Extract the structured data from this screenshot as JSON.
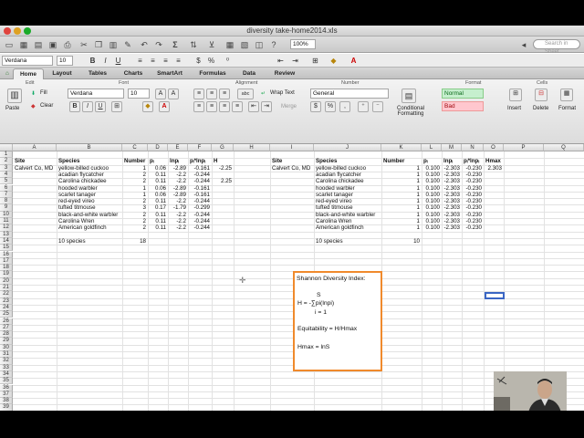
{
  "window": {
    "title": "diversity take-home2014.xls"
  },
  "toolbar": {
    "zoom": "100%",
    "search_placeholder": "Search in Sheet"
  },
  "formatbar": {
    "font": "Verdana",
    "size": "10",
    "bold": "B",
    "italic": "I",
    "underline": "U"
  },
  "ribbon_tabs": [
    "Home",
    "Layout",
    "Tables",
    "Charts",
    "SmartArt",
    "Formulas",
    "Data",
    "Review"
  ],
  "ribbon": {
    "groups": {
      "edit": "Edit",
      "font": "Font",
      "alignment": "Alignment",
      "number": "Number",
      "format": "Format",
      "cells": "Cells"
    },
    "fill": "Fill",
    "clear": "Clear",
    "paste": "Paste",
    "font": "Verdana",
    "size": "10",
    "wrap": "Wrap Text",
    "merge": "Merge",
    "number_format": "General",
    "styles": {
      "normal": "Normal",
      "bad": "Bad"
    },
    "conditional": "Conditional Formatting",
    "insert": "Insert",
    "delete": "Delete",
    "format_btn": "Format",
    "abc": "abc"
  },
  "grid": {
    "columns": [
      "A",
      "B",
      "C",
      "D",
      "E",
      "F",
      "G",
      "H",
      "I",
      "J",
      "K",
      "L",
      "M",
      "N",
      "O",
      "P",
      "Q"
    ],
    "rows": [
      "1",
      "2",
      "3",
      "4",
      "5",
      "6",
      "7",
      "8",
      "9",
      "10",
      "11",
      "12",
      "13",
      "14",
      "15",
      "16",
      "17",
      "18",
      "19",
      "20",
      "21",
      "22",
      "23",
      "24",
      "25",
      "26",
      "27",
      "28",
      "29",
      "30",
      "31",
      "32",
      "33",
      "34",
      "35",
      "36",
      "37",
      "38",
      "39"
    ],
    "left": {
      "headers": [
        "Site",
        "Species",
        "Number",
        "pᵢ",
        "lnpᵢ",
        "pᵢ*lnpᵢ",
        "H"
      ],
      "site": "Calvert Co, MD",
      "rows": [
        [
          "yellow-billed cuckoo",
          "1",
          "0.06",
          "-2.89",
          "-0.161",
          "-2.25"
        ],
        [
          "acadian flycatcher",
          "2",
          "0.11",
          "-2.2",
          "-0.244",
          ""
        ],
        [
          "Carolina chickadee",
          "2",
          "0.11",
          "-2.2",
          "-0.244",
          "2.25"
        ],
        [
          "hooded warbler",
          "1",
          "0.06",
          "-2.89",
          "-0.161",
          ""
        ],
        [
          "scarlet tanager",
          "1",
          "0.06",
          "-2.89",
          "-0.161",
          ""
        ],
        [
          "red-eyed vireo",
          "2",
          "0.11",
          "-2.2",
          "-0.244",
          ""
        ],
        [
          "tufted titmouse",
          "3",
          "0.17",
          "-1.79",
          "-0.299",
          ""
        ],
        [
          "black-and-white warbler",
          "2",
          "0.11",
          "-2.2",
          "-0.244",
          ""
        ],
        [
          "Carolina Wren",
          "2",
          "0.11",
          "-2.2",
          "-0.244",
          ""
        ],
        [
          "American goldfinch",
          "2",
          "0.11",
          "-2.2",
          "-0.244",
          ""
        ]
      ],
      "summary": "10 species",
      "total": "18"
    },
    "right": {
      "headers": [
        "Site",
        "Species",
        "Number",
        "pᵢ",
        "lnpᵢ",
        "pᵢ*lnpᵢ",
        "Hmax"
      ],
      "site": "Calvert Co, MD",
      "hmax": "2.303",
      "rows": [
        [
          "yellow-billed cuckoo",
          "1",
          "0.100",
          "-2.303",
          "-0.230"
        ],
        [
          "acadian flycatcher",
          "1",
          "0.100",
          "-2.303",
          "-0.230"
        ],
        [
          "Carolina chickadee",
          "1",
          "0.100",
          "-2.303",
          "-0.230"
        ],
        [
          "hooded warbler",
          "1",
          "0.100",
          "-2.303",
          "-0.230"
        ],
        [
          "scarlet tanager",
          "1",
          "0.100",
          "-2.303",
          "-0.230"
        ],
        [
          "red-eyed vireo",
          "1",
          "0.100",
          "-2.303",
          "-0.230"
        ],
        [
          "tufted titmouse",
          "1",
          "0.100",
          "-2.303",
          "-0.230"
        ],
        [
          "black-and-white warbler",
          "1",
          "0.100",
          "-2.303",
          "-0.230"
        ],
        [
          "Carolina Wren",
          "1",
          "0.100",
          "-2.303",
          "-0.230"
        ],
        [
          "American goldfinch",
          "1",
          "0.100",
          "-2.303",
          "-0.230"
        ]
      ],
      "summary": "10 species",
      "total": "10"
    }
  },
  "infobox": {
    "title": "Shannon Diversity Index:",
    "sup": "S",
    "formula": "H = -∑pi(lnpi)",
    "sub": "i = 1",
    "equitability": "Equitability = H/Hmax",
    "hmax": "Hmax = lnS"
  },
  "colors": {
    "accent": "#f08a2c",
    "selection": "#3a66c4",
    "good": "#c6efce",
    "bad": "#ffc7ce"
  }
}
